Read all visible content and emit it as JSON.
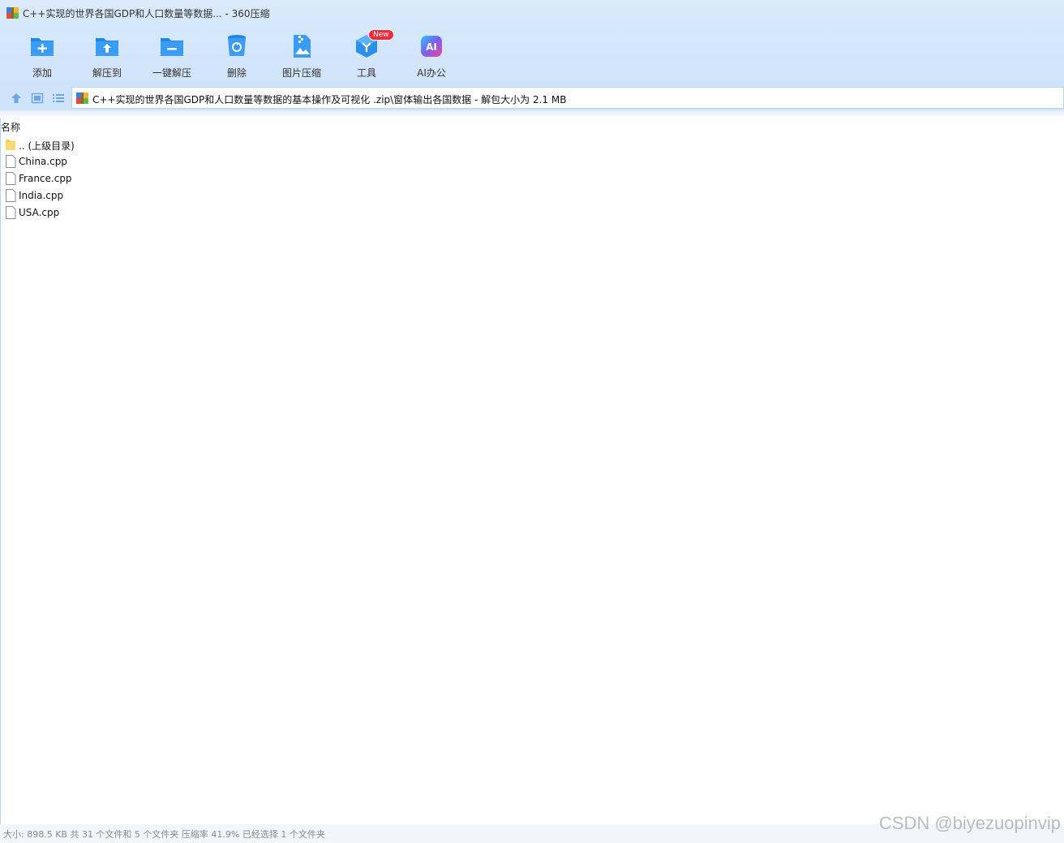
{
  "window": {
    "title": "C++实现的世界各国GDP和人口数量等数据... - 360压缩"
  },
  "toolbar": {
    "items": [
      {
        "label": "添加",
        "icon": "add-folder-icon"
      },
      {
        "label": "解压到",
        "icon": "extract-to-icon"
      },
      {
        "label": "一键解压",
        "icon": "one-click-extract-icon"
      },
      {
        "label": "删除",
        "icon": "recycle-bin-icon"
      },
      {
        "label": "图片压缩",
        "icon": "image-compress-icon"
      },
      {
        "label": "工具",
        "icon": "tools-icon",
        "badge": "New"
      },
      {
        "label": "AI办公",
        "icon": "ai-office-icon",
        "icon_text": "AI"
      }
    ]
  },
  "nav": {
    "path": "C++实现的世界各国GDP和人口数量等数据的基本操作及可视化 .zip\\窗体输出各国数据 - 解包大小为 2.1 MB"
  },
  "file_list": {
    "column_name": "名称",
    "rows": [
      {
        "name": ".. (上级目录)",
        "type": "folder"
      },
      {
        "name": "China.cpp",
        "type": "file"
      },
      {
        "name": "France.cpp",
        "type": "file"
      },
      {
        "name": "India.cpp",
        "type": "file"
      },
      {
        "name": "USA.cpp",
        "type": "file"
      }
    ]
  },
  "status": {
    "text": "大小: 898.5 KB 共 31 个文件和 5 个文件夹 压缩率 41.9% 已经选择 1 个文件夹"
  },
  "watermark": "CSDN @biyezuopinvip",
  "colors": {
    "accent": "#2b8ff0",
    "toolbar_bg": "#d6e8fb",
    "badge": "#ee2c3c"
  }
}
